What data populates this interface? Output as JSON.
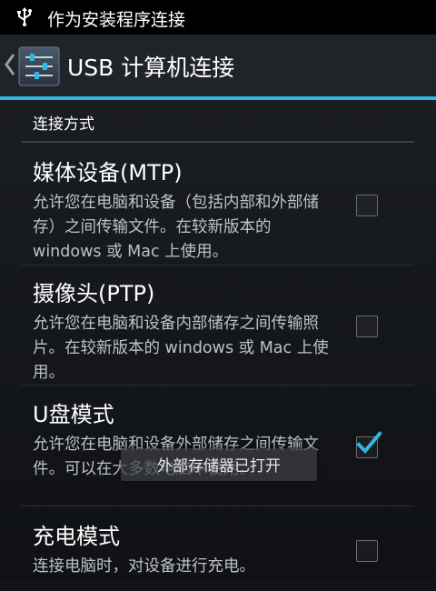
{
  "status_bar": {
    "icon": "usb-icon",
    "notification_text": "作为安装程序连接"
  },
  "action_bar": {
    "back_icon": "chevron-left-icon",
    "app_icon": "settings-sliders-icon",
    "title": "USB 计算机连接"
  },
  "category": {
    "label": "连接方式"
  },
  "options": [
    {
      "title": "媒体设备(MTP)",
      "summary": "允许您在电脑和设备（包括内部和外部储存）之间传输文件。在较新版本的 windows 或 Mac 上使用。",
      "checked": false
    },
    {
      "title": "摄像头(PTP)",
      "summary": "允许您在电脑和设备内部储存之间传输照片。在较新版本的 windows 或 Mac 上使用。",
      "checked": false
    },
    {
      "title": "U盘模式",
      "summary": "允许您在电脑和设备外部储存之间传输文件。可以在大多数电脑中使用。",
      "checked": true
    },
    {
      "title": "充电模式",
      "summary": "连接电脑时，对设备进行充电。",
      "checked": false
    }
  ],
  "toast": {
    "text": "外部存储器已打开"
  },
  "colors": {
    "accent": "#33b5e5",
    "background": "#121417",
    "action_bar": "#202327"
  }
}
